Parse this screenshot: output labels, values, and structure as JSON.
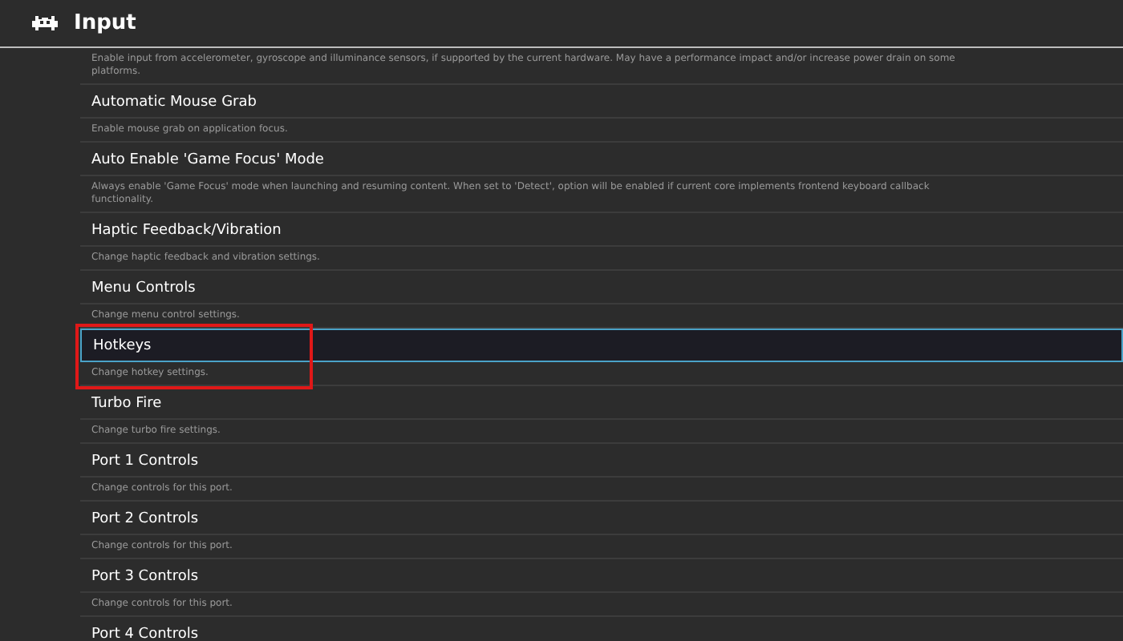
{
  "header": {
    "title": "Input"
  },
  "items": [
    {
      "description": "Enable input from accelerometer, gyroscope and illuminance sensors, if supported by the current hardware. May have a performance impact and/or increase power drain on some platforms."
    },
    {
      "title": "Automatic Mouse Grab",
      "description": "Enable mouse grab on application focus.",
      "selected": false,
      "highlighted": false
    },
    {
      "title": "Auto Enable 'Game Focus' Mode",
      "description": "Always enable 'Game Focus' mode when launching and resuming content. When set to 'Detect', option will be enabled if current core implements frontend keyboard callback functionality.",
      "selected": false,
      "highlighted": false
    },
    {
      "title": "Haptic Feedback/Vibration",
      "description": "Change haptic feedback and vibration settings.",
      "selected": false,
      "highlighted": false
    },
    {
      "title": "Menu Controls",
      "description": "Change menu control settings.",
      "selected": false,
      "highlighted": false
    },
    {
      "title": "Hotkeys",
      "description": "Change hotkey settings.",
      "selected": true,
      "highlighted": true
    },
    {
      "title": "Turbo Fire",
      "description": "Change turbo fire settings.",
      "selected": false,
      "highlighted": false
    },
    {
      "title": "Port 1 Controls",
      "description": "Change controls for this port.",
      "selected": false,
      "highlighted": false
    },
    {
      "title": "Port 2 Controls",
      "description": "Change controls for this port.",
      "selected": false,
      "highlighted": false
    },
    {
      "title": "Port 3 Controls",
      "description": "Change controls for this port.",
      "selected": false,
      "highlighted": false
    },
    {
      "title": "Port 4 Controls",
      "selected": false,
      "highlighted": false
    }
  ]
}
